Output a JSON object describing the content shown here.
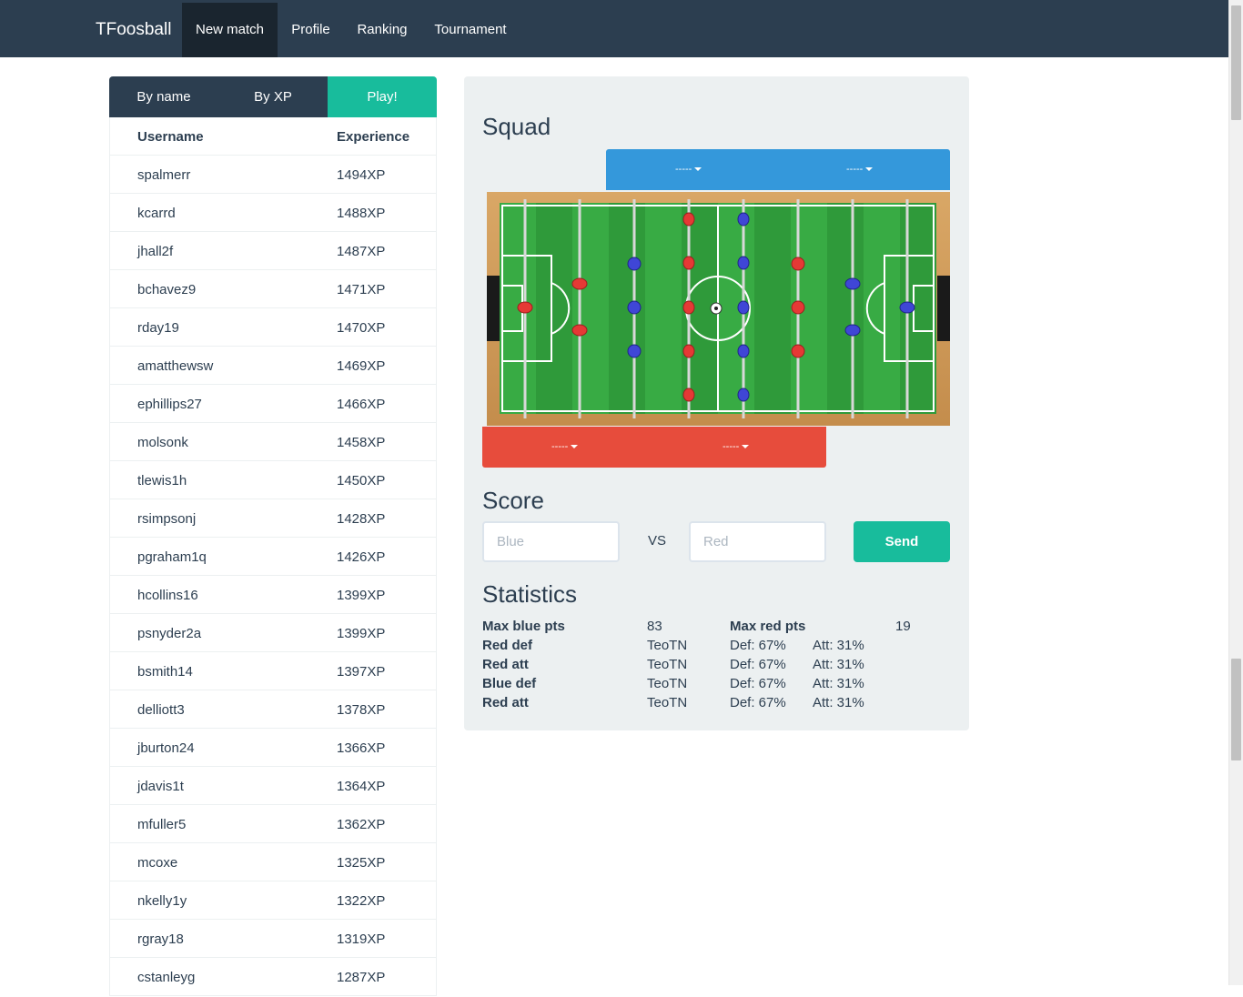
{
  "navbar": {
    "brand": "TFoosball",
    "items": [
      "New match",
      "Profile",
      "Ranking",
      "Tournament"
    ],
    "active": "New match"
  },
  "sort_tabs": {
    "by_name": "By name",
    "by_xp": "By XP",
    "play": "Play!"
  },
  "ranking_table": {
    "headers": {
      "username": "Username",
      "experience": "Experience"
    },
    "rows": [
      {
        "username": "spalmerr",
        "xp": "1494XP"
      },
      {
        "username": "kcarrd",
        "xp": "1488XP"
      },
      {
        "username": "jhall2f",
        "xp": "1487XP"
      },
      {
        "username": "bchavez9",
        "xp": "1471XP"
      },
      {
        "username": "rday19",
        "xp": "1470XP"
      },
      {
        "username": "amatthewsw",
        "xp": "1469XP"
      },
      {
        "username": "ephillips27",
        "xp": "1466XP"
      },
      {
        "username": "molsonk",
        "xp": "1458XP"
      },
      {
        "username": "tlewis1h",
        "xp": "1450XP"
      },
      {
        "username": "rsimpsonj",
        "xp": "1428XP"
      },
      {
        "username": "pgraham1q",
        "xp": "1426XP"
      },
      {
        "username": "hcollins16",
        "xp": "1399XP"
      },
      {
        "username": "psnyder2a",
        "xp": "1399XP"
      },
      {
        "username": "bsmith14",
        "xp": "1397XP"
      },
      {
        "username": "delliott3",
        "xp": "1378XP"
      },
      {
        "username": "jburton24",
        "xp": "1366XP"
      },
      {
        "username": "jdavis1t",
        "xp": "1364XP"
      },
      {
        "username": "mfuller5",
        "xp": "1362XP"
      },
      {
        "username": "mcoxe",
        "xp": "1325XP"
      },
      {
        "username": "nkelly1y",
        "xp": "1322XP"
      },
      {
        "username": "rgray18",
        "xp": "1319XP"
      },
      {
        "username": "cstanleyg",
        "xp": "1287XP"
      }
    ]
  },
  "squad": {
    "title": "Squad",
    "blue_selects": [
      "-----",
      "-----"
    ],
    "red_selects": [
      "-----",
      "-----"
    ]
  },
  "score": {
    "title": "Score",
    "blue_placeholder": "Blue",
    "red_placeholder": "Red",
    "vs": "VS",
    "send": "Send"
  },
  "statistics": {
    "title": "Statistics",
    "max_blue_label": "Max blue pts",
    "max_blue_value": "83",
    "max_red_label": "Max red pts",
    "max_red_value": "19",
    "rows": [
      {
        "label": "Red def",
        "player": "TeoTN",
        "def": "Def: 67%",
        "att": "Att: 31%"
      },
      {
        "label": "Red att",
        "player": "TeoTN",
        "def": "Def: 67%",
        "att": "Att: 31%"
      },
      {
        "label": "Blue def",
        "player": "TeoTN",
        "def": "Def: 67%",
        "att": "Att: 31%"
      },
      {
        "label": "Red att",
        "player": "TeoTN",
        "def": "Def: 67%",
        "att": "Att: 31%"
      }
    ]
  },
  "colors": {
    "navbar": "#2c3e50",
    "active_nav": "#1a252f",
    "accent_green": "#18bc9c",
    "blue_team": "#3498db",
    "red_team": "#e74c3c",
    "panel": "#ecf0f1"
  }
}
